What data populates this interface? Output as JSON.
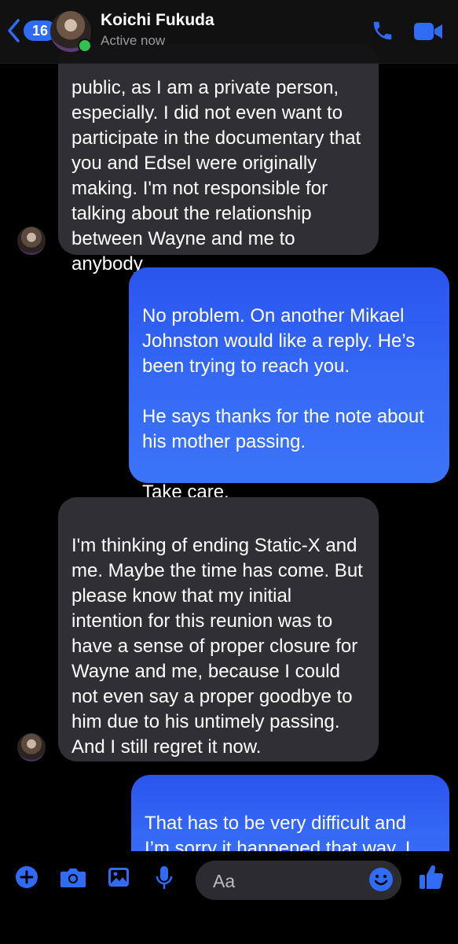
{
  "header": {
    "back_count": "16",
    "contact_name": "Koichi Fukuda",
    "contact_status": "Active now",
    "icons": [
      "chevron-left-icon",
      "phone-icon",
      "video-camera-icon"
    ]
  },
  "messages": [
    {
      "sender": "contact",
      "text": "public, as I am a private person, especially. I did not even want to participate in the documentary that you and Edsel were originally making. I'm not responsible for talking about the relationship between Wayne and me to anybody."
    },
    {
      "sender": "me",
      "text": "No problem. On another Mikael Johnston would like a reply. He’s been trying to reach you.\n\nHe says thanks for the note about his mother passing.\n\nTake care."
    },
    {
      "sender": "contact",
      "text": "I'm thinking of ending Static-X and me. Maybe the time has come. But please know that my initial intention for this reunion was to have a sense of proper closure for Wayne and me, because I could not even say a proper goodbye to him due to his untimely passing. And I still regret it now."
    },
    {
      "sender": "me",
      "text": "That has to be very difficult and I’m sorry it happened that way. I hope the experience of"
    }
  ],
  "composer": {
    "placeholder": "Aa",
    "icons": [
      "plus-icon",
      "camera-icon",
      "image-icon",
      "microphone-icon",
      "emoji-icon",
      "thumbs-up-icon"
    ]
  },
  "colors": {
    "accent": "#3478f6",
    "outgoing_bubble": "#3468f5",
    "incoming_bubble": "#303034",
    "background": "#000000",
    "active_dot": "#31c24d"
  }
}
